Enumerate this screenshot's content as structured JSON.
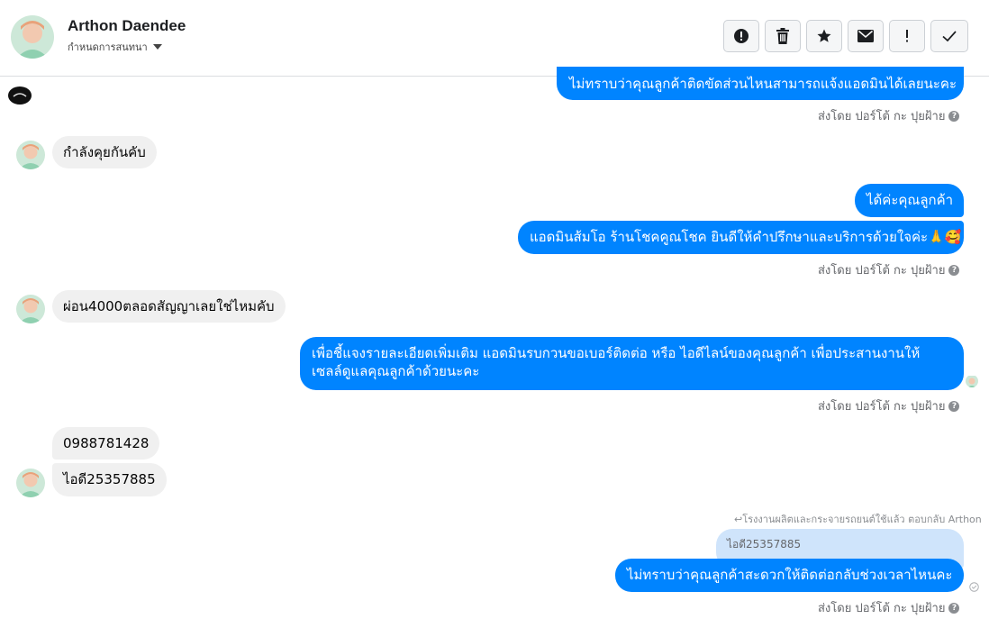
{
  "header": {
    "contact_name": "Arthon Daendee",
    "assign_label": "กำหนดการสนทนา"
  },
  "toolbar": {
    "buttons": [
      "spam-icon",
      "trash-icon",
      "star-icon",
      "envelope-icon",
      "exclamation-icon",
      "check-icon"
    ]
  },
  "messages": [
    {
      "dir": "out",
      "text": "ไม่ทราบว่าคุณลูกค้าติดขัดส่วนไหนสามารถแจ้งแอดมินได้เลยนะคะ"
    },
    {
      "dir": "in",
      "text": "กำลังคุยกันคับ"
    },
    {
      "dir": "out",
      "text": "ได้ค่ะคุณลูกค้า"
    },
    {
      "dir": "out",
      "text": "แอดมินส้มโอ ร้านโชคคูณโชค ยินดีให้คำปรึกษาและบริการด้วยใจค่ะ🙏🥰"
    },
    {
      "dir": "in",
      "text": "ผ่อน4000ตลอดสัญญาเลยใช่ไหมคับ"
    },
    {
      "dir": "out",
      "line1": "เพื่อชี้แจงรายละเอียดเพิ่มเติม แอดมินรบกวนขอเบอร์ติดต่อ หรือ ไอดีไลน์ของคุณลูกค้า เพื่อประสานงานให้",
      "line2": "เซลล์ดูแลคุณลูกค้าด้วยนะคะ"
    },
    {
      "dir": "in",
      "text": "0988781428"
    },
    {
      "dir": "in",
      "text": "ไอดี25357885"
    },
    {
      "dir": "out",
      "text": "ไม่ทราบว่าคุณลูกค้าสะดวกให้ติดต่อกลับช่วงเวลาไหนคะ"
    }
  ],
  "sent_by": "ส่งโดย ปอร์โต้ กะ ปุยฝ้าย",
  "reply": {
    "note": "↩โรงงานผลิตและกระจายรถยนต์ใช้แล้ว ตอบกลับ Arthon",
    "quoted": "ไอดี25357885"
  },
  "colors": {
    "outgoing_bubble": "#0084ff",
    "incoming_bubble": "#f0f0f0",
    "quoted_bubble": "#cfe4fb"
  }
}
